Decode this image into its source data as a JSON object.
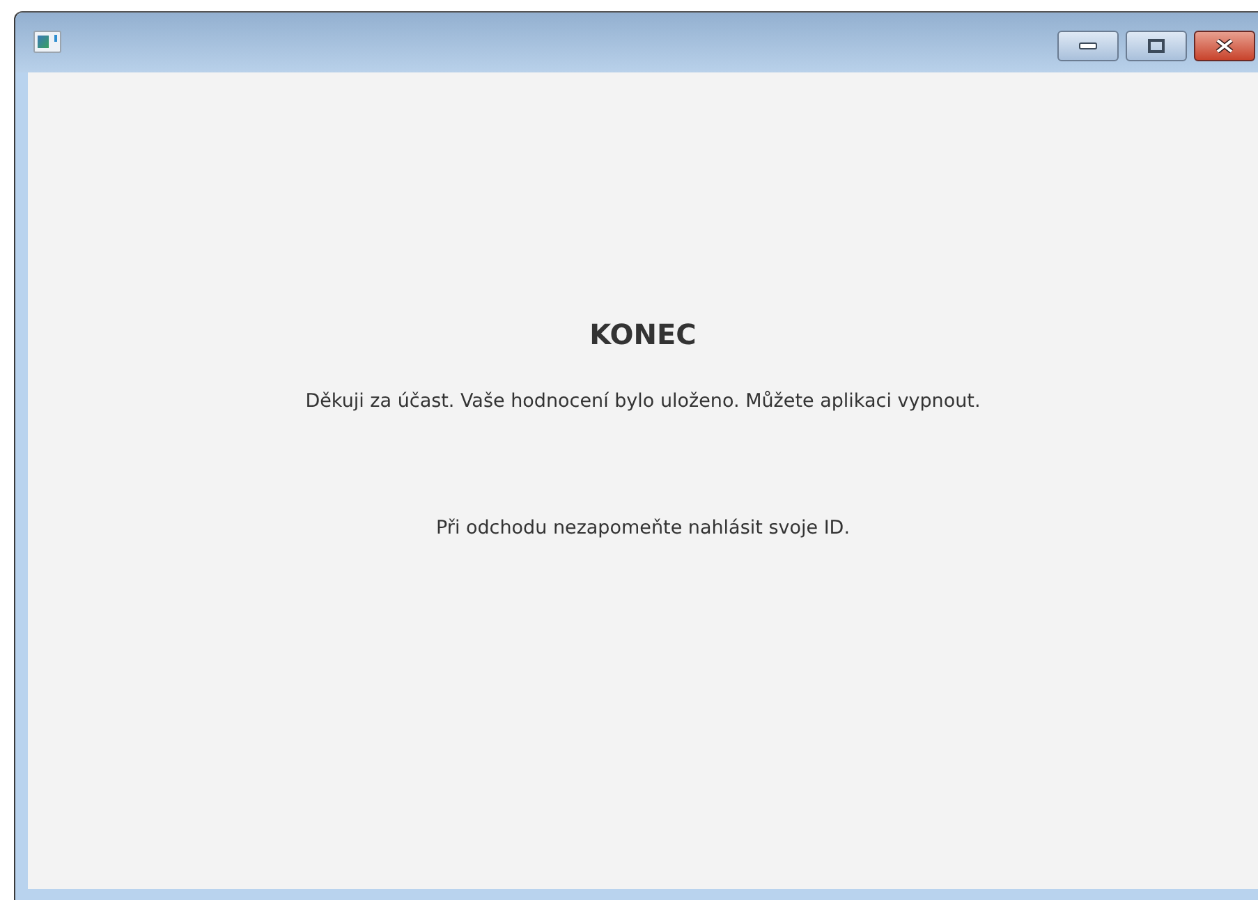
{
  "content": {
    "heading": "KONEC",
    "message": "Děkuji za účast. Vaše hodnocení bylo uloženo. Můžete aplikaci vypnout.",
    "note": "Při odchodu nezapomeňte nahlásit svoje ID."
  }
}
